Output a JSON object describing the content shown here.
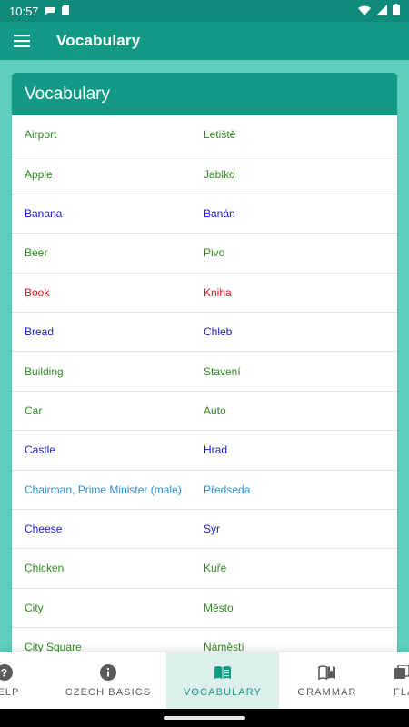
{
  "status_bar": {
    "time": "10:57"
  },
  "app_bar": {
    "title": "Vocabulary"
  },
  "card": {
    "header": "Vocabulary"
  },
  "vocabulary": [
    {
      "en": "Airport",
      "cz": "Letiště",
      "color": "#2e8b1e"
    },
    {
      "en": "Apple",
      "cz": "Jablko",
      "color": "#2e8b1e"
    },
    {
      "en": "Banana",
      "cz": "Banán",
      "color": "#1a1ad6"
    },
    {
      "en": "Beer",
      "cz": "Pivo",
      "color": "#2e8b1e"
    },
    {
      "en": "Book",
      "cz": "Kniha",
      "color": "#d21a1a"
    },
    {
      "en": "Bread",
      "cz": "Chleb",
      "color": "#1a1ad6"
    },
    {
      "en": "Building",
      "cz": "Stavení",
      "color": "#2e8b1e"
    },
    {
      "en": "Car",
      "cz": "Auto",
      "color": "#2e8b1e"
    },
    {
      "en": "Castle",
      "cz": "Hrad",
      "color": "#1a1ad6"
    },
    {
      "en": "Chairman, Prime Minister (male)",
      "cz": "Předseda",
      "color": "#2a8fd6"
    },
    {
      "en": "Cheese",
      "cz": "Sýr",
      "color": "#1a1ad6"
    },
    {
      "en": "Chicken",
      "cz": "Kuře",
      "color": "#2e8b1e"
    },
    {
      "en": "City",
      "cz": "Město",
      "color": "#2e8b1e"
    },
    {
      "en": "City Square",
      "cz": "Náměstí",
      "color": "#2e8b1e"
    }
  ],
  "bottom_nav": {
    "help": "HELP",
    "czech_basics": "CZECH BASICS",
    "vocabulary": "VOCABULARY",
    "grammar": "GRAMMAR",
    "flashcards": "FLASHCARDS"
  },
  "colors": {
    "primary": "#139a85",
    "primary_dark": "#0f8a78",
    "background": "#5ecfbd"
  }
}
